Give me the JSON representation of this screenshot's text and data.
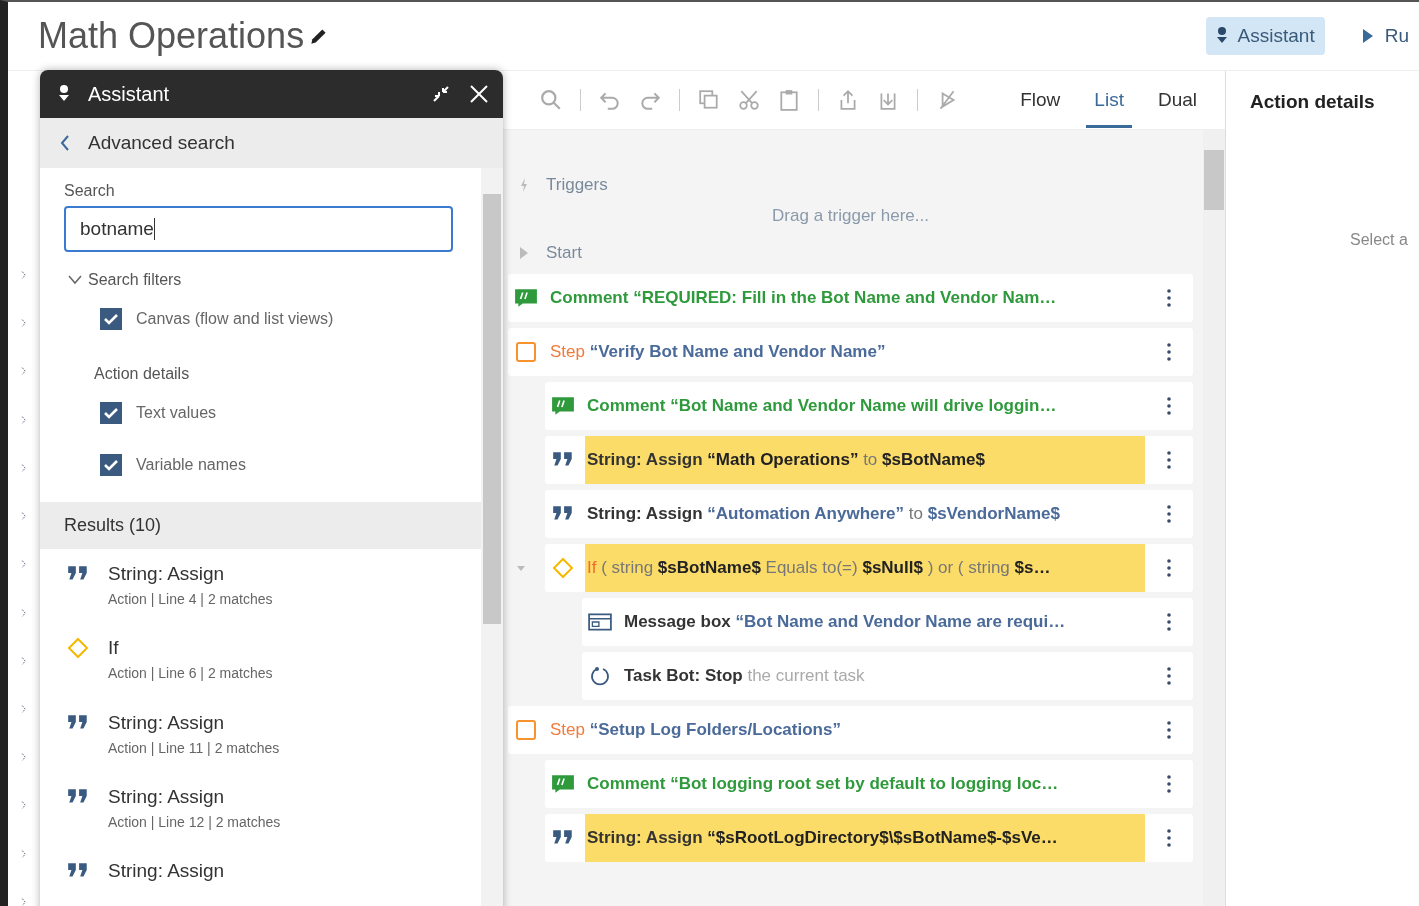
{
  "title": "Math Operations",
  "header_buttons": [
    {
      "label": "Assistant",
      "selected": true,
      "kind": "assistant"
    },
    {
      "label": "Ru",
      "selected": false,
      "kind": "run"
    }
  ],
  "assistant": {
    "title": "Assistant",
    "back_label": "Advanced search",
    "search_label": "Search",
    "search_value": "botname",
    "filters": {
      "label": "Search filters",
      "expanded": true,
      "items": [
        {
          "label": "Canvas (flow and list views)",
          "checked": true,
          "kind": "check"
        },
        {
          "label": "Action details",
          "kind": "heading"
        },
        {
          "label": "Text values",
          "checked": true,
          "kind": "check"
        },
        {
          "label": "Variable names",
          "checked": true,
          "kind": "check"
        }
      ]
    },
    "results_label": "Results (10)",
    "results": [
      {
        "kind": "string",
        "title": "String: Assign",
        "meta": "Action | Line 4 | 2 matches"
      },
      {
        "kind": "if",
        "title": "If",
        "meta": "Action | Line 6 | 2 matches"
      },
      {
        "kind": "string",
        "title": "String: Assign",
        "meta": "Action | Line 11 | 2 matches"
      },
      {
        "kind": "string",
        "title": "String: Assign",
        "meta": "Action | Line 12 | 2 matches"
      },
      {
        "kind": "string",
        "title": "String: Assign"
      }
    ]
  },
  "view_tabs": [
    {
      "label": "Flow",
      "selected": false
    },
    {
      "label": "List",
      "selected": true
    },
    {
      "label": "Dual",
      "selected": false
    }
  ],
  "triggers": {
    "label": "Triggers",
    "hint": "Drag a trigger here..."
  },
  "start_label": "Start",
  "rows": [
    {
      "kind": "comment",
      "highlighted": false,
      "parts": [
        {
          "kind": "keyword",
          "text": "Comment"
        },
        {
          "kind": "value",
          "text": "“REQUIRED: Fill in the Bot Name and Vendor Nam…"
        }
      ]
    },
    {
      "kind": "step",
      "highlighted": false,
      "parts": [
        {
          "kind": "keyword",
          "text": "Step"
        },
        {
          "kind": "value",
          "text": "“Verify Bot Name and Vendor Name”"
        }
      ],
      "children": [
        {
          "kind": "comment",
          "highlighted": false,
          "parts": [
            {
              "kind": "keyword",
              "text": "Comment"
            },
            {
              "kind": "value",
              "text": "“Bot Name and Vendor Name will drive loggin…"
            }
          ]
        },
        {
          "kind": "string",
          "highlighted": true,
          "parts": [
            {
              "kind": "keyword",
              "text": "String: Assign"
            },
            {
              "kind": "value",
              "text": "“Math Operations”"
            },
            {
              "kind": "plain",
              "text": "to"
            },
            {
              "kind": "var",
              "text": "$sBotName$"
            }
          ]
        },
        {
          "kind": "string",
          "highlighted": false,
          "parts": [
            {
              "kind": "keyword",
              "text": "String: Assign"
            },
            {
              "kind": "value",
              "text": "“Automation Anywhere”"
            },
            {
              "kind": "plain",
              "text": "to"
            },
            {
              "kind": "var",
              "text": "$sVendorName$"
            }
          ]
        },
        {
          "kind": "if",
          "highlighted": true,
          "expanded": true,
          "parts": [
            {
              "kind": "keyword",
              "text": "If"
            },
            {
              "kind": "plain",
              "text": "( string"
            },
            {
              "kind": "var",
              "text": "$sBotName$"
            },
            {
              "kind": "plain",
              "text": "Equals to(=)"
            },
            {
              "kind": "var",
              "text": "$sNull$"
            },
            {
              "kind": "plain",
              "text": ") or ( string"
            },
            {
              "kind": "var",
              "text": "$s…"
            }
          ],
          "children": [
            {
              "kind": "message",
              "highlighted": false,
              "parts": [
                {
                  "kind": "keyword",
                  "text": "Message box"
                },
                {
                  "kind": "value",
                  "text": "“Bot Name and Vendor Name are requi…"
                }
              ]
            },
            {
              "kind": "stop",
              "highlighted": false,
              "parts": [
                {
                  "kind": "keyword",
                  "text": "Task Bot: Stop"
                },
                {
                  "kind": "plain",
                  "text": "the current task"
                }
              ]
            }
          ]
        }
      ]
    },
    {
      "kind": "step",
      "highlighted": false,
      "parts": [
        {
          "kind": "keyword",
          "text": "Step"
        },
        {
          "kind": "value",
          "text": "“Setup Log Folders/Locations”"
        }
      ],
      "children": [
        {
          "kind": "comment",
          "highlighted": false,
          "parts": [
            {
              "kind": "keyword",
              "text": "Comment"
            },
            {
              "kind": "value",
              "text": "“Bot logging root set by default to logging loc…"
            }
          ]
        },
        {
          "kind": "string",
          "highlighted": true,
          "parts": [
            {
              "kind": "keyword",
              "text": "String: Assign"
            },
            {
              "kind": "value",
              "text": "“$sRootLogDirectory$\\$sBotName$-$sVe…"
            }
          ]
        }
      ]
    }
  ],
  "details": {
    "title": "Action details",
    "hint": "Select a"
  }
}
